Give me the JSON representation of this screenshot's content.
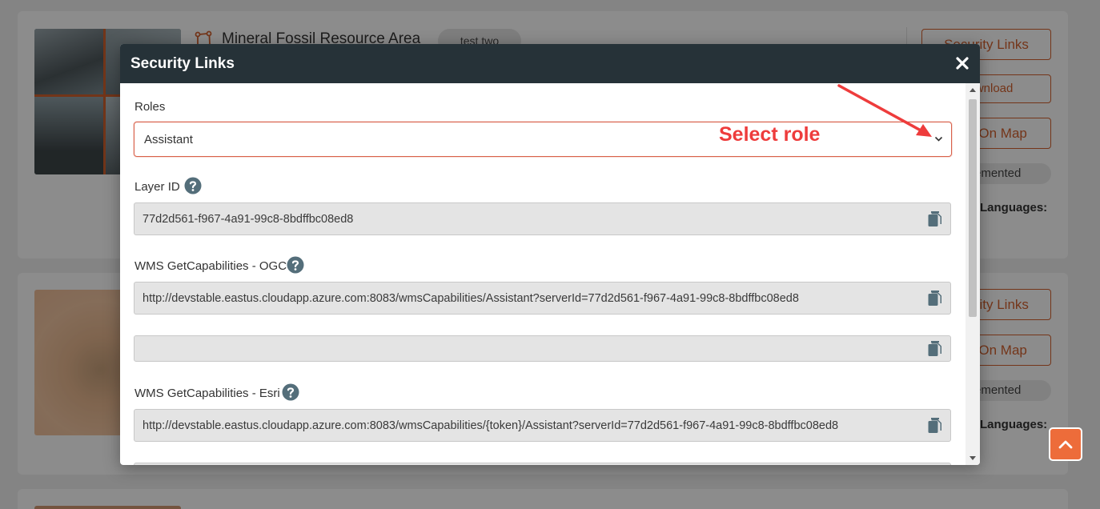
{
  "background": {
    "card1": {
      "title": "Mineral Fossil Resource Area",
      "tag": "test two",
      "buttons": [
        "Security Links",
        "Download",
        "View On Map"
      ],
      "status": "Implemented",
      "languages_label": "Languages:"
    },
    "card2": {
      "buttons": [
        "Security Links",
        "View On Map"
      ],
      "status": "Implemented",
      "languages_label": "Languages:"
    }
  },
  "modal": {
    "title": "Security Links",
    "roles": {
      "label": "Roles",
      "selected": "Assistant"
    },
    "fields": [
      {
        "label": "Layer ID",
        "value": "77d2d561-f967-4a91-99c8-8bdffbc08ed8",
        "has_help": true
      },
      {
        "label": "WMS GetCapabilities - OGC",
        "value": "http://devstable.eastus.cloudapp.azure.com:8083/wmsCapabilities/Assistant?serverId=77d2d561-f967-4a91-99c8-8bdffbc08ed8",
        "has_help": true
      },
      {
        "label": "",
        "value": "",
        "has_help": false
      },
      {
        "label": "WMS GetCapabilities - Esri",
        "value": "http://devstable.eastus.cloudapp.azure.com:8083/wmsCapabilities/{token}/Assistant?serverId=77d2d561-f967-4a91-99c8-8bdffbc08ed8",
        "has_help": true
      }
    ]
  },
  "annotation": {
    "text": "Select role",
    "color": "#ee3c3c"
  },
  "colors": {
    "accent": "#d4622f",
    "header": "#263238",
    "scroll_top": "#ed6c3a"
  }
}
